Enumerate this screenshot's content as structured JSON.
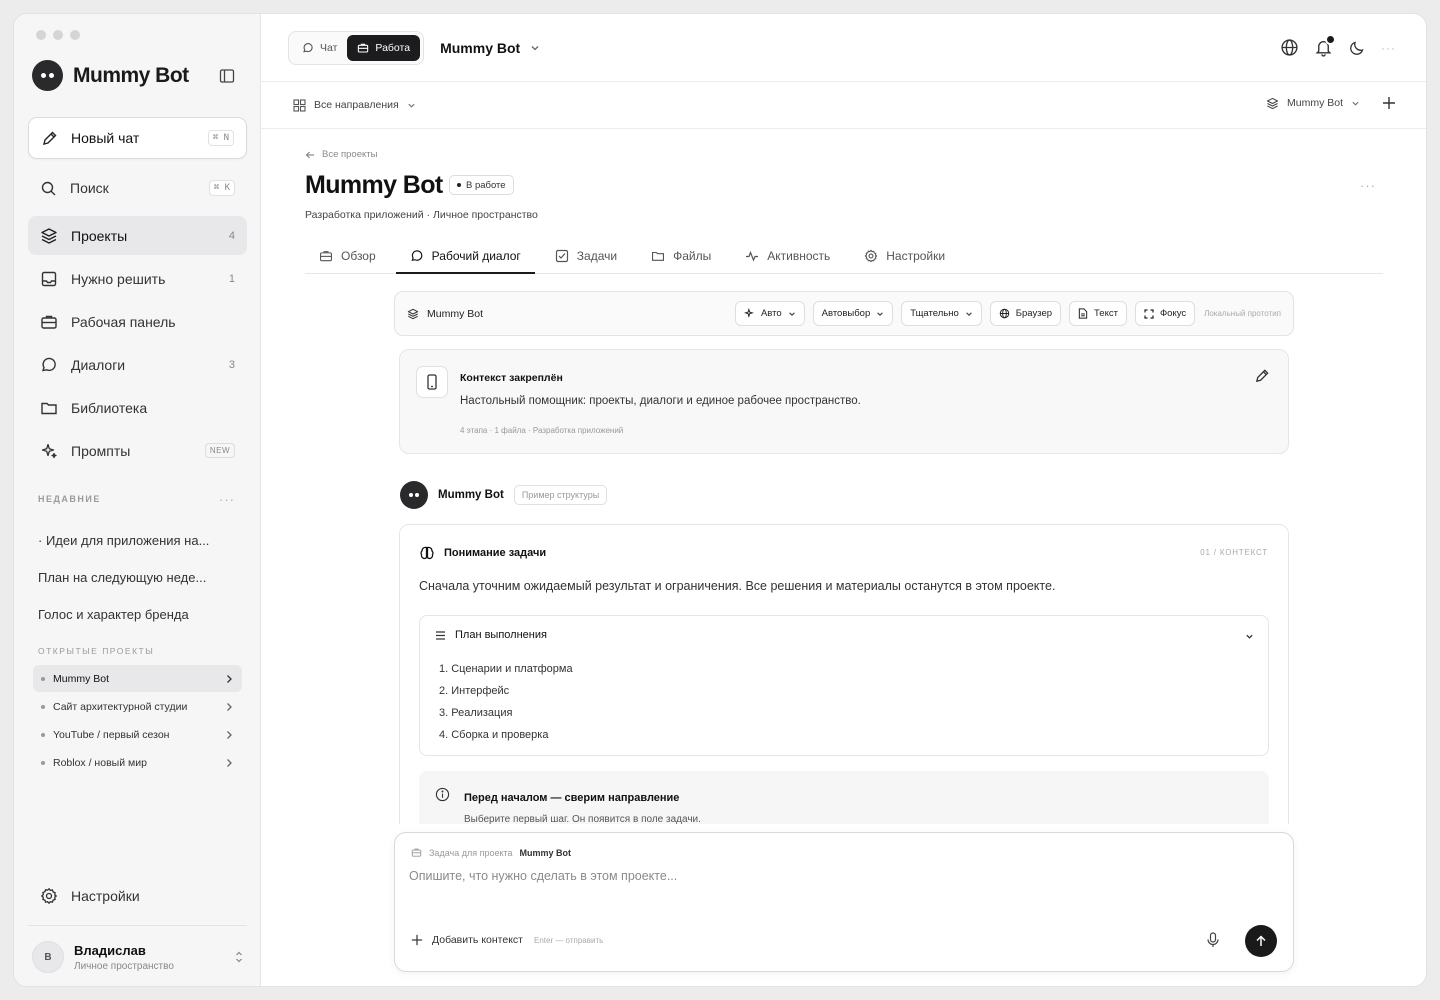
{
  "sidebar": {
    "brand": "Mummy Bot",
    "new_chat": {
      "label": "Новый чат",
      "shortcut": "⌘ N"
    },
    "search": {
      "label": "Поиск",
      "shortcut": "⌘ K"
    },
    "nav": [
      {
        "label": "Проекты",
        "count": "4",
        "icon": "layers-icon"
      },
      {
        "label": "Нужно решить",
        "count": "1",
        "icon": "inbox-icon"
      },
      {
        "label": "Рабочая панель",
        "count": "",
        "icon": "briefcase-icon"
      },
      {
        "label": "Диалоги",
        "count": "3",
        "icon": "chat-icon"
      },
      {
        "label": "Библиотека",
        "count": "",
        "icon": "folder-icon"
      },
      {
        "label": "Промпты",
        "badge": "NEW",
        "icon": "sparkle-icon"
      }
    ],
    "recent_title": "НЕДАВНИЕ",
    "recent": [
      "· Идеи для приложения на...",
      "План на следующую неде...",
      "Голос и характер бренда"
    ],
    "open_projects_title": "ОТКРЫТЫЕ ПРОЕКТЫ",
    "open_projects": [
      "Mummy Bot",
      "Сайт архитектурной студии",
      "YouTube / первый сезон",
      "Roblox / новый мир"
    ],
    "settings": "Настройки",
    "user": {
      "initial": "В",
      "name": "Владислав",
      "subtitle": "Личное пространство"
    }
  },
  "topbar": {
    "mode_chat": "Чат",
    "mode_work": "Работа",
    "title": "Mummy Bot"
  },
  "subbar": {
    "directions": "Все направления",
    "project_selector": "Mummy Bot"
  },
  "page": {
    "back": "Все проекты",
    "title": "Mummy Bot",
    "status": "В работе",
    "subtitle": "Разработка приложений · Личное пространство",
    "tabs": [
      "Обзор",
      "Рабочий диалог",
      "Задачи",
      "Файлы",
      "Активность",
      "Настройки"
    ]
  },
  "toolbar": {
    "title": "Mummy Bot",
    "chips": [
      "Авто",
      "Автовыбор",
      "Тщательно",
      "Браузер",
      "Текст",
      "Фокус"
    ],
    "proto": "Локальный прототип"
  },
  "pinned": {
    "title": "Контекст закреплён",
    "text": "Настольный помощник: проекты, диалоги и единое рабочее пространство.",
    "meta": "4 этапа · 1 файла · Разработка приложений"
  },
  "message": {
    "author": "Mummy Bot",
    "tag": "Пример структуры",
    "heading": "Понимание задачи",
    "step": "01 / КОНТЕКСТ",
    "text": "Сначала уточним ожидаемый результат и ограничения. Все решения и материалы останутся в этом проекте.",
    "plan_title": "План выполнения",
    "plan": [
      "1. Сценарии и платформа",
      "2. Интерфейс",
      "3. Реализация",
      "4. Сборка и проверка"
    ],
    "notice_title": "Перед началом — сверим направление",
    "notice_text": "Выберите первый шаг. Он появится в поле задачи."
  },
  "composer": {
    "label": "Задача для проекта",
    "project": "Mummy Bot",
    "placeholder": "Опишите, что нужно сделать в этом проекте...",
    "add_context": "Добавить контекст",
    "hint": "Enter — отправить"
  }
}
